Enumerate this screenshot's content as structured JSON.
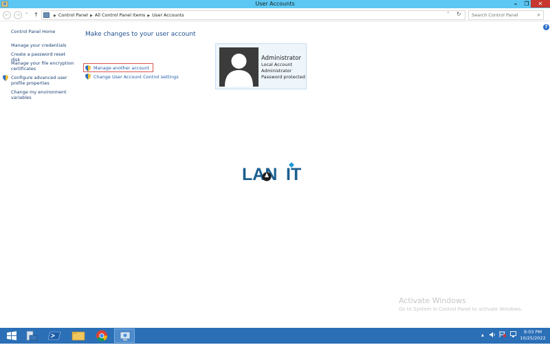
{
  "window": {
    "title": "User Accounts",
    "minimize": "–",
    "restore": "❐",
    "close": "✕"
  },
  "nav": {
    "back": "←",
    "forward": "→",
    "recent": "˅",
    "up": "↑",
    "breadcrumbs": [
      "Control Panel",
      "All Control Panel Items",
      "User Accounts"
    ],
    "dropdown": "˅",
    "refresh": "↻",
    "search_placeholder": "Search Control Panel",
    "search_icon": "⌕"
  },
  "sidebar": {
    "home": "Control Panel Home",
    "items": [
      "Manage your credentials",
      "Create a password reset disk",
      "Manage your file encryption certificates",
      "Configure advanced user profile properties",
      "Change my environment variables"
    ]
  },
  "main": {
    "heading": "Make changes to your user account",
    "tasks": [
      "Manage another account",
      "Change User Account Control settings"
    ],
    "account": {
      "name": "Administrator",
      "lines": [
        "Local Account",
        "Administrator",
        "Password protected"
      ]
    }
  },
  "help": "?",
  "logo": {
    "text_left": "LAN",
    "text_right": "IT"
  },
  "watermark": {
    "line1": "Activate Windows",
    "line2": "Go to System in Control Panel to activate Windows."
  },
  "taskbar": {
    "apps": [
      "start-icon",
      "server-manager-icon",
      "powershell-icon",
      "file-explorer-icon",
      "chrome-icon",
      "control-panel-icon"
    ],
    "tray": {
      "arrow": "▲"
    },
    "time": "9:03 PM",
    "date": "10/25/2022"
  },
  "colors": {
    "titlebar": "#5bc7f2",
    "taskbar": "#2b6fb7",
    "link": "#1e5aa8",
    "close": "#c7372f",
    "highlight_box": "#d9534f"
  }
}
